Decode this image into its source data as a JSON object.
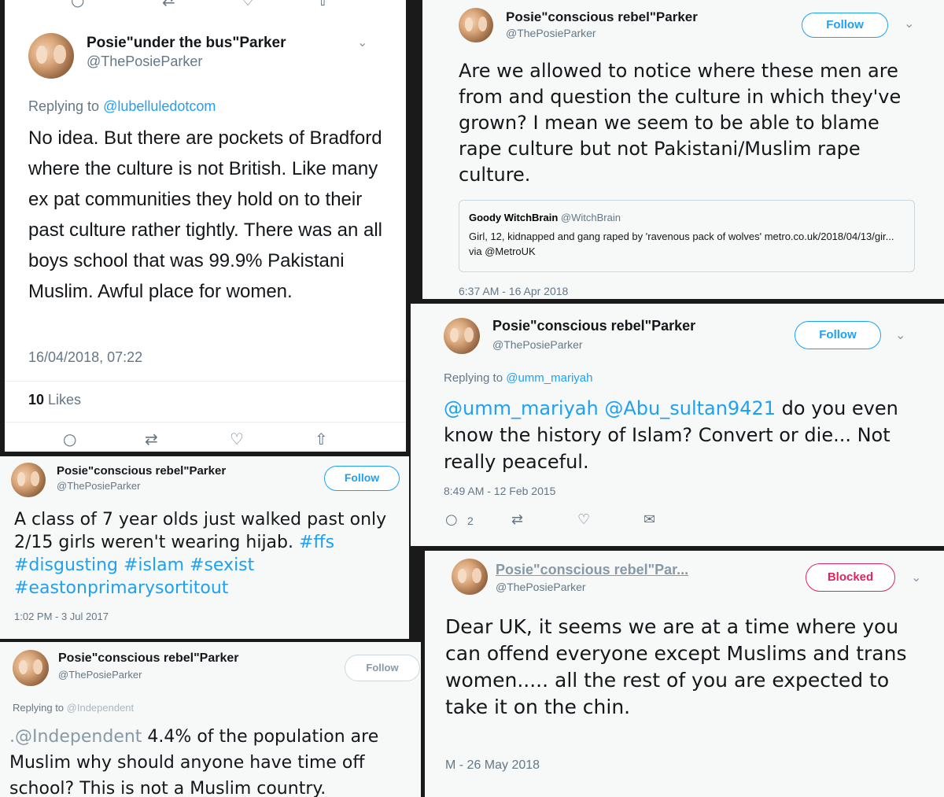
{
  "tweet_a": {
    "name": "Posie\"under the bus\"Parker",
    "handle": "@ThePosieParker",
    "replying_prefix": "Replying to ",
    "replying_to": "@lubelluledotcom",
    "text": "No idea.  But there are pockets of Bradford where the culture is not British. Like many ex pat communities they hold on to their past culture rather tightly.  There was an all boys school that was 99.9% Pakistani Muslim. Awful place for women.",
    "timestamp": "16/04/2018, 07:22",
    "likes_count": "10",
    "likes_label": " Likes"
  },
  "tweet_b": {
    "name": "Posie\"conscious rebel\"Parker",
    "handle": "@ThePosieParker",
    "follow_label": "Follow",
    "text": "Are we allowed to notice where these men are from and question the culture in which they've grown?   I mean we seem to be able to blame rape culture but not Pakistani/Muslim rape culture.",
    "quote_name": "Goody WitchBrain",
    "quote_handle": "@WitchBrain",
    "quote_text": "Girl, 12, kidnapped and gang raped by 'ravenous pack of wolves' metro.co.uk/2018/04/13/gir... via @MetroUK",
    "timestamp": "6:37 AM - 16 Apr 2018"
  },
  "tweet_c": {
    "name": "Posie\"conscious rebel\"Parker",
    "handle": "@ThePosieParker",
    "follow_label": "Follow",
    "replying_prefix": "Replying to ",
    "replying_to": "@umm_mariyah",
    "mention_1": "@umm_mariyah",
    "mention_2": "@Abu_sultan9421",
    "text_rest": " do you even know the history of Islam?  Convert or die... Not really peaceful.",
    "timestamp": "8:49 AM - 12 Feb 2015",
    "reply_count": "2"
  },
  "tweet_d": {
    "name": "Posie\"conscious rebel\"Parker",
    "handle": "@ThePosieParker",
    "follow_label": "Follow",
    "text_plain": "A class of 7 year olds just walked past only 2/15 girls weren't wearing hijab.  ",
    "hashtags": "#ffs #disgusting #islam #sexist #eastonprimarysortitout",
    "timestamp": "1:02 PM - 3 Jul 2017"
  },
  "tweet_e": {
    "name": "Posie\"conscious rebel\"Par...",
    "handle": "@ThePosieParker",
    "blocked_label": "Blocked",
    "text": "Dear UK, it seems we are at a time where you can offend everyone except Muslims and trans women.....  all the rest of you are expected to take it on the chin.",
    "timestamp": "M - 26 May 2018"
  },
  "tweet_f": {
    "name": "Posie\"conscious rebel\"Parker",
    "handle": "@ThePosieParker",
    "follow_label": "Follow",
    "replying_prefix": "Replying to ",
    "replying_to": "@Independent",
    "mention": ".@Independent",
    "text_rest": " 4.4% of the population are Muslim why should anyone have time off school?  This is not a Muslim country."
  },
  "colors": {
    "accent": "#1da1f2",
    "blocked": "#e0245e",
    "text": "#14171a",
    "muted": "#657786"
  }
}
